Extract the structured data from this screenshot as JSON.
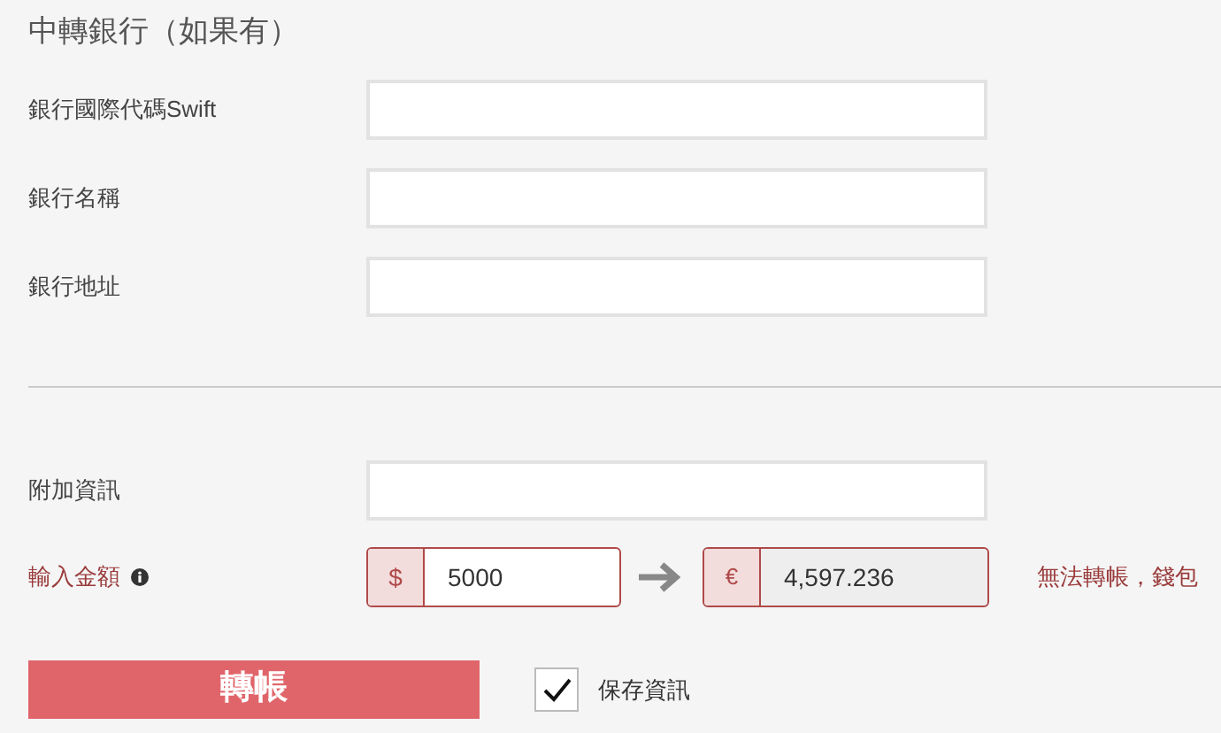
{
  "section_title": "中轉銀行（如果有）",
  "bank_fields": [
    {
      "label": "銀行國際代碼Swift"
    },
    {
      "label": "銀行名稱"
    },
    {
      "label": "銀行地址"
    }
  ],
  "extra_info": {
    "label": "附加資訊"
  },
  "amount": {
    "label": "輸入金額",
    "from_currency": "$",
    "from_value": "5000",
    "to_currency": "€",
    "to_value": "4,597.236",
    "error": "無法轉帳，錢包"
  },
  "transfer_button": "轉帳",
  "save_info": {
    "label": "保存資訊",
    "checked": true
  }
}
